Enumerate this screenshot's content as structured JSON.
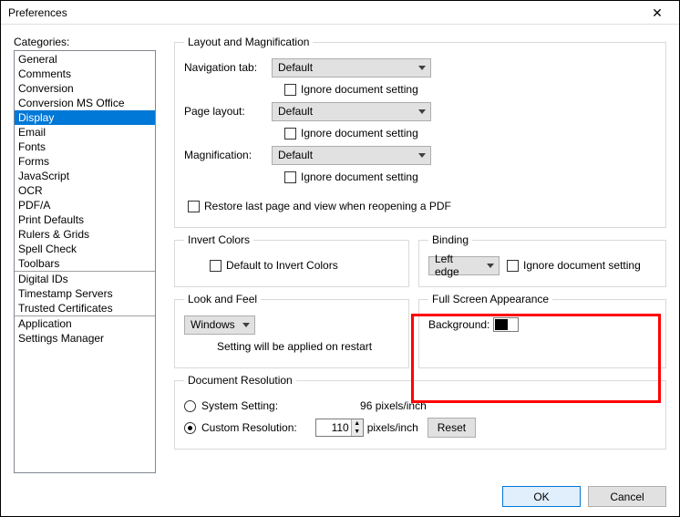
{
  "window": {
    "title": "Preferences"
  },
  "categories": {
    "label": "Categories:",
    "group1": [
      "General",
      "Comments",
      "Conversion",
      "Conversion MS Office",
      "Display",
      "Email",
      "Fonts",
      "Forms",
      "JavaScript",
      "OCR",
      "PDF/A",
      "Print Defaults",
      "Rulers & Grids",
      "Spell Check",
      "Toolbars"
    ],
    "group2": [
      "Digital IDs",
      "Timestamp Servers",
      "Trusted Certificates"
    ],
    "group3": [
      "Application",
      "Settings Manager"
    ],
    "selected": "Display"
  },
  "layoutMag": {
    "legend": "Layout and Magnification",
    "navTabLabel": "Navigation tab:",
    "navTabValue": "Default",
    "pageLayoutLabel": "Page layout:",
    "pageLayoutValue": "Default",
    "magLabel": "Magnification:",
    "magValue": "Default",
    "ignore": "Ignore document setting",
    "restore": "Restore last page and view when reopening a PDF"
  },
  "invert": {
    "legend": "Invert Colors",
    "default": "Default to Invert Colors"
  },
  "binding": {
    "legend": "Binding",
    "value": "Left edge",
    "ignore": "Ignore document setting"
  },
  "look": {
    "legend": "Look and Feel",
    "value": "Windows",
    "note": "Setting will be applied on restart"
  },
  "fullscreen": {
    "legend": "Full Screen Appearance",
    "bgLabel": "Background:",
    "bgColor": "#000000"
  },
  "docres": {
    "legend": "Document Resolution",
    "sysLabel": "System Setting:",
    "sysValue": "96 pixels/inch",
    "customLabel": "Custom Resolution:",
    "customValue": "110",
    "unit": "pixels/inch",
    "reset": "Reset"
  },
  "footer": {
    "ok": "OK",
    "cancel": "Cancel"
  }
}
